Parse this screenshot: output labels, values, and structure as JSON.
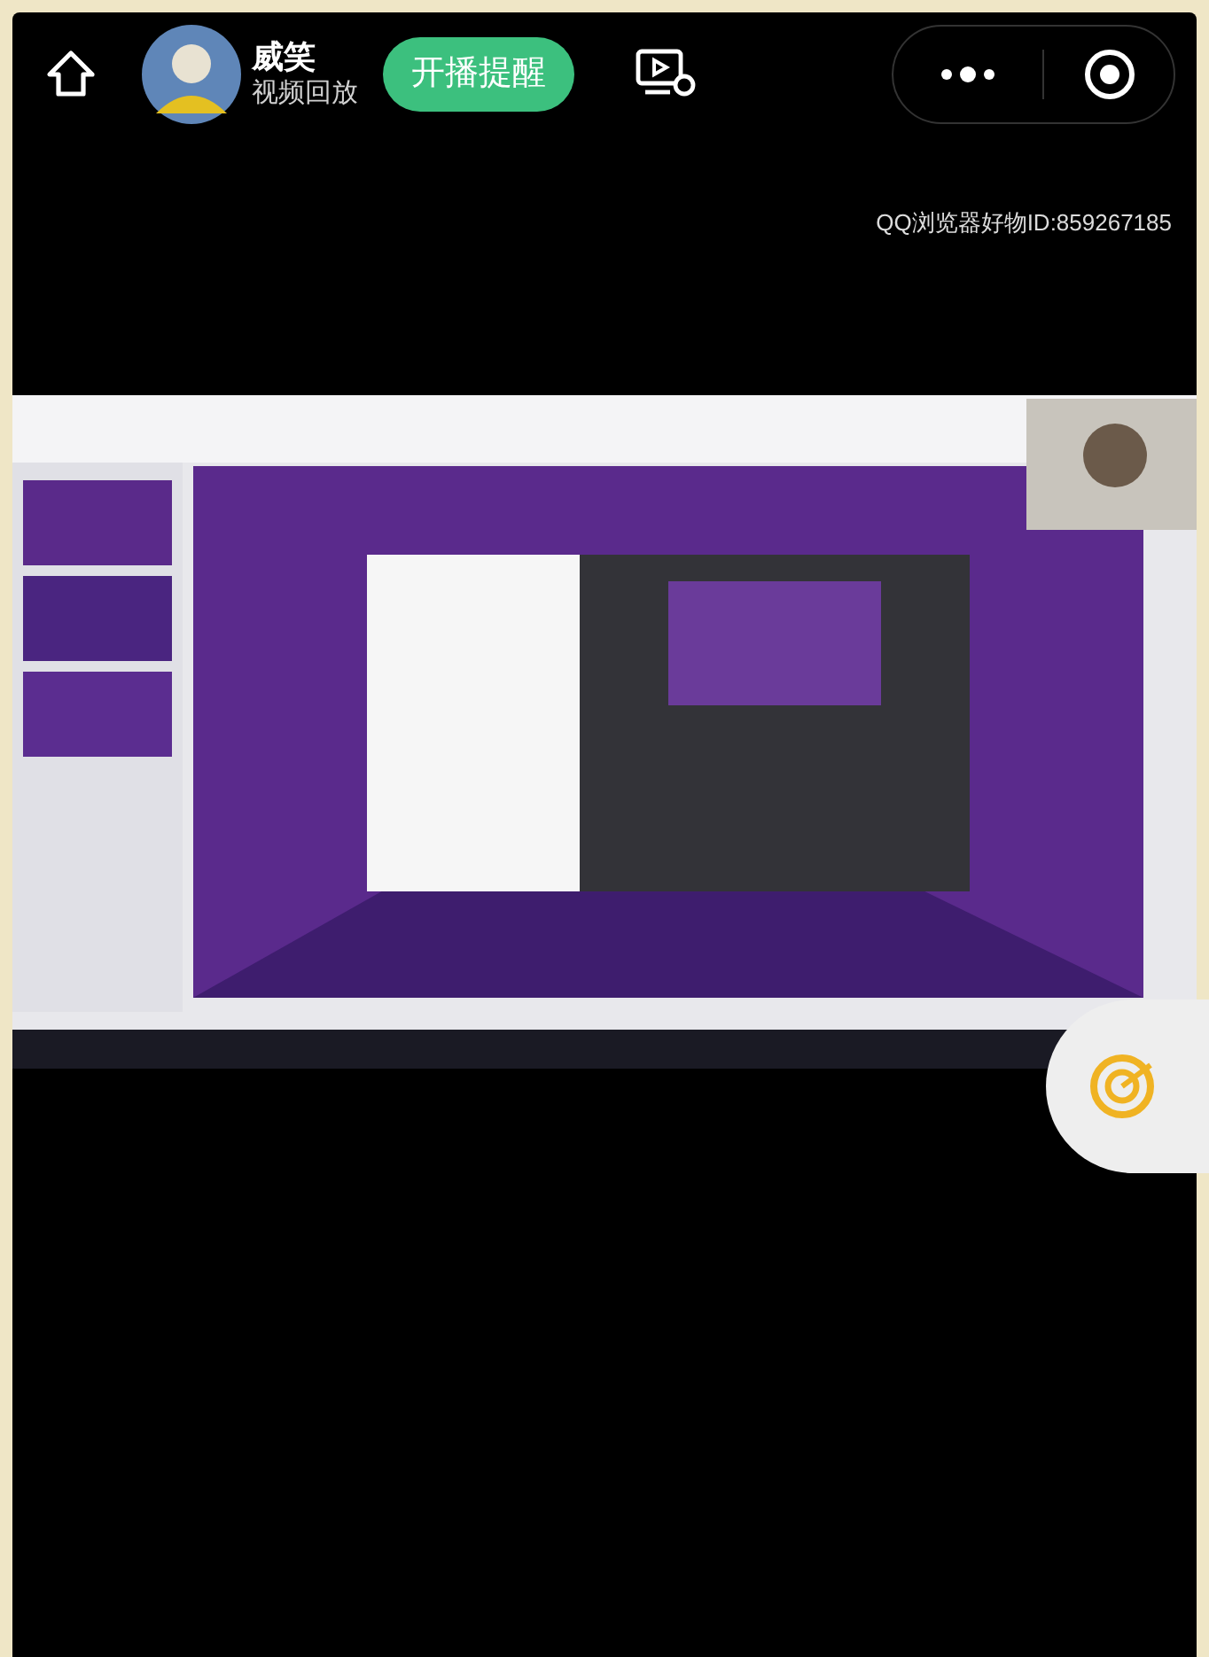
{
  "header": {
    "streamer_name": "威笑",
    "subtitle": "视频回放",
    "follow_button": "开播提醒"
  },
  "overlay_text": "QQ浏览器好物ID:859267185"
}
